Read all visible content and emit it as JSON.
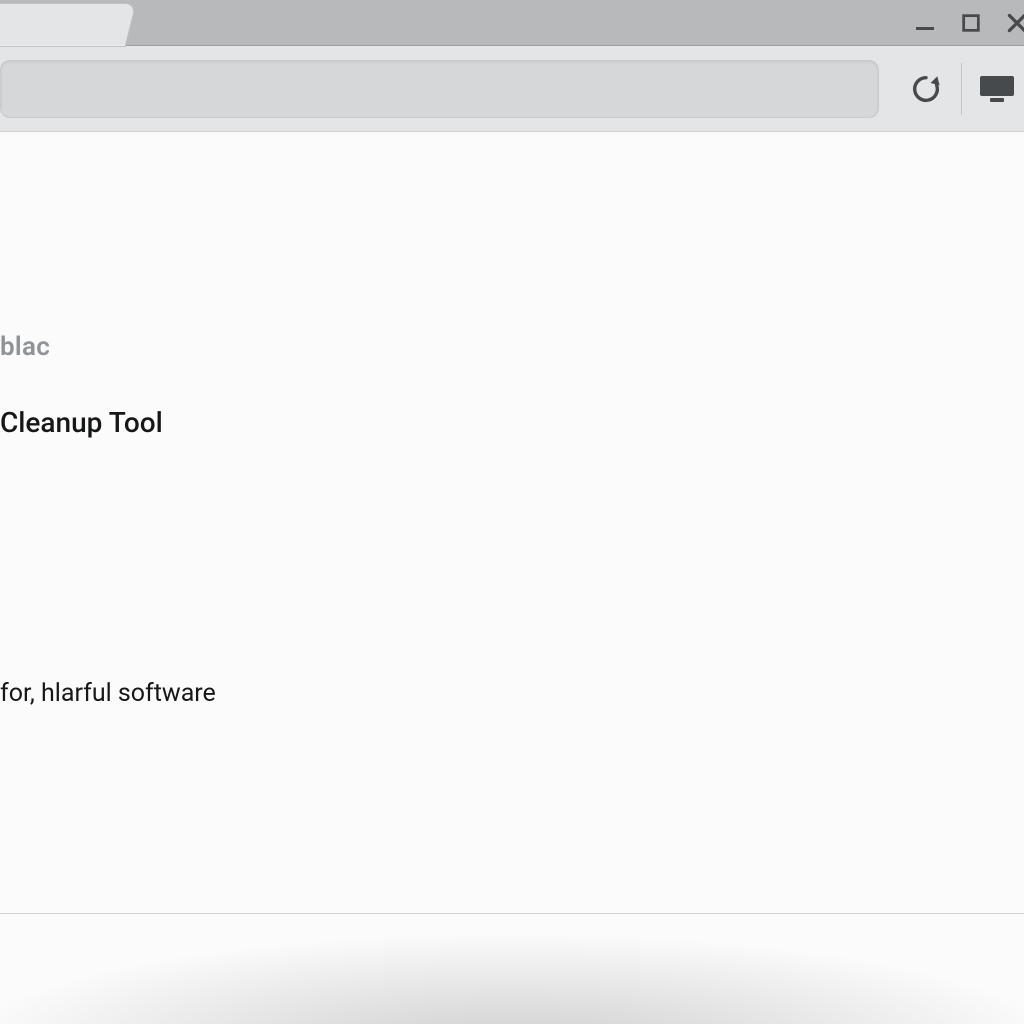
{
  "window_controls": {
    "minimize": "minimize",
    "maximize": "maximize",
    "close": "close"
  },
  "toolbar": {
    "omnibox_value": "",
    "omnibox_placeholder": "",
    "reload_label": "reload",
    "cast_label": "cast"
  },
  "page": {
    "small_label": "blac",
    "heading": "Cleanup Tool",
    "description": "for, hlarful software"
  }
}
